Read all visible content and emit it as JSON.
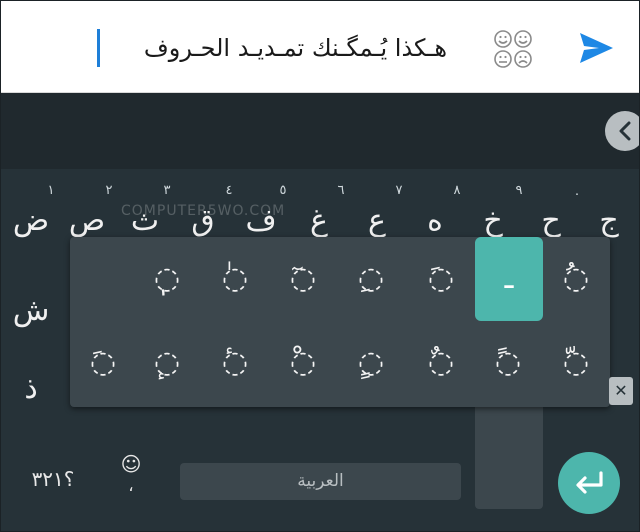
{
  "compose": {
    "text": "هـكذا يُـمگـنك تمـديـد الحـروف",
    "send_icon": "send-icon",
    "emoji_panel_icon": "emoji-faces-icon"
  },
  "keyboard": {
    "row1": [
      "ج",
      "ح",
      "خ",
      "ه",
      "ع",
      "غ",
      "ف",
      "ق",
      "ث",
      "ص",
      "ض"
    ],
    "row1_hints": [
      "٠",
      "٩",
      "٨",
      "٧",
      "٦",
      "٥",
      "٤",
      "٣",
      "٢",
      "١"
    ],
    "row2_visible": [
      "ش"
    ],
    "row3_visible": [
      "ذ"
    ],
    "watermark": "COMPUTER5WO.COM",
    "popup": {
      "selected": "ـ",
      "row1": [
        "ُ◌",
        "ـ",
        "َ◌",
        "ِ◌",
        "ٓ◌",
        "ٰ◌",
        "ٖ◌"
      ],
      "row2": [
        "ّ◌",
        "ً◌",
        "ٌ◌",
        "ٍ◌",
        "ْ◌",
        "ٔ◌",
        "ٕ◌",
        "َ◌"
      ]
    },
    "symbols_label": "؟٣٢١",
    "emoji_key": {
      "smile": "☺",
      "comma": "،"
    },
    "space_label": "العربية",
    "backspace_glyph": "✕"
  },
  "colors": {
    "accent": "#4db6ac",
    "send": "#1e88e5",
    "keyboard_bg": "#263238",
    "popup_bg": "#3c474d"
  }
}
